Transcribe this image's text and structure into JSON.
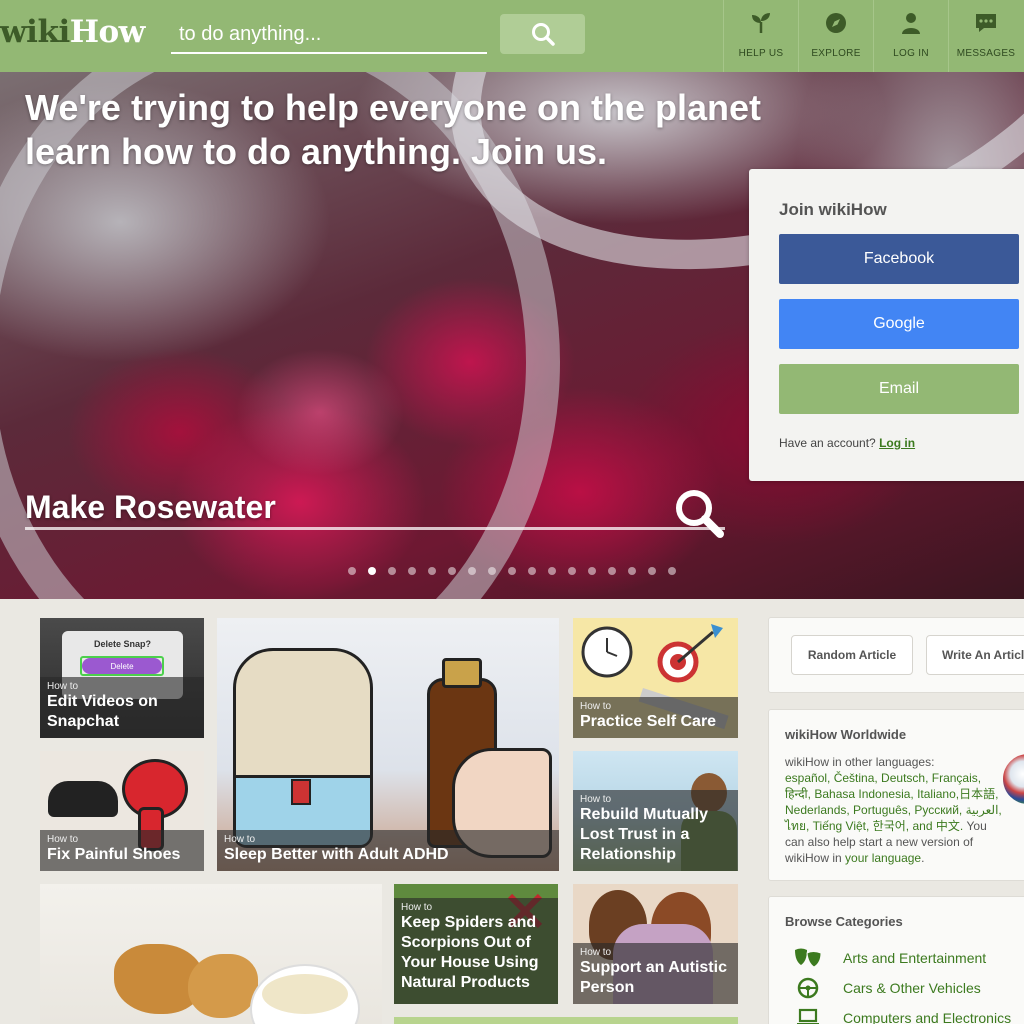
{
  "header": {
    "logo_wiki": "wiki",
    "logo_how": "How",
    "search_placeholder": "to do anything...",
    "nav": [
      {
        "label": "HELP US",
        "icon": "sprout-icon"
      },
      {
        "label": "EXPLORE",
        "icon": "compass-icon"
      },
      {
        "label": "LOG IN",
        "icon": "user-icon"
      },
      {
        "label": "MESSAGES",
        "icon": "chat-bubble-icon"
      }
    ]
  },
  "hero": {
    "headline": "We're trying to help everyone on the planet learn how to do anything. Join us.",
    "caption": "Make Rosewater",
    "slide_count": 17,
    "active_slide": 2
  },
  "join": {
    "title": "Join wikiHow",
    "facebook": "Facebook",
    "google": "Google",
    "email": "Email",
    "have_account": "Have an account?",
    "login": "Log in"
  },
  "tiles": [
    {
      "howto": "How to",
      "title": "Edit Videos on Snapchat"
    },
    {
      "howto": "How to",
      "title": "Sleep Better with Adult ADHD"
    },
    {
      "howto": "How to",
      "title": "Practice Self Care"
    },
    {
      "howto": "How to",
      "title": "Fix Painful Shoes"
    },
    {
      "howto": "How to",
      "title": "Rebuild Mutually Lost Trust in a Relationship"
    },
    {
      "howto": "How to",
      "title": "Keep Spiders and Scorpions Out of Your House Using Natural Products"
    },
    {
      "howto": "How to",
      "title": "Support an Autistic Person"
    }
  ],
  "snapchat_art": {
    "dialog_title": "Delete Snap?",
    "dialog_button": "Delete"
  },
  "sidebar": {
    "random_article": "Random Article",
    "write_article": "Write An Article",
    "worldwide_title": "wikiHow Worldwide",
    "worldwide_intro": "wikiHow in other languages:",
    "languages": "español, Čeština, Deutsch, Français, हिन्दी, Bahasa Indonesia, Italiano,日本語, Nederlands, Português, Русский, العربية, ไทย, Tiếng Việt, 한국어, and 中文.",
    "worldwide_help": "You can also help start a new version of wikiHow in",
    "worldwide_link": "your language",
    "categories_title": "Browse Categories",
    "categories": [
      {
        "label": "Arts and Entertainment",
        "icon": "theater-masks-icon"
      },
      {
        "label": "Cars & Other Vehicles",
        "icon": "steering-wheel-icon"
      },
      {
        "label": "Computers and Electronics",
        "icon": "laptop-icon"
      }
    ]
  },
  "colors": {
    "header_green": "#93b874",
    "link_green": "#3c7a1f",
    "facebook": "#3b5998",
    "google": "#4285f4"
  }
}
